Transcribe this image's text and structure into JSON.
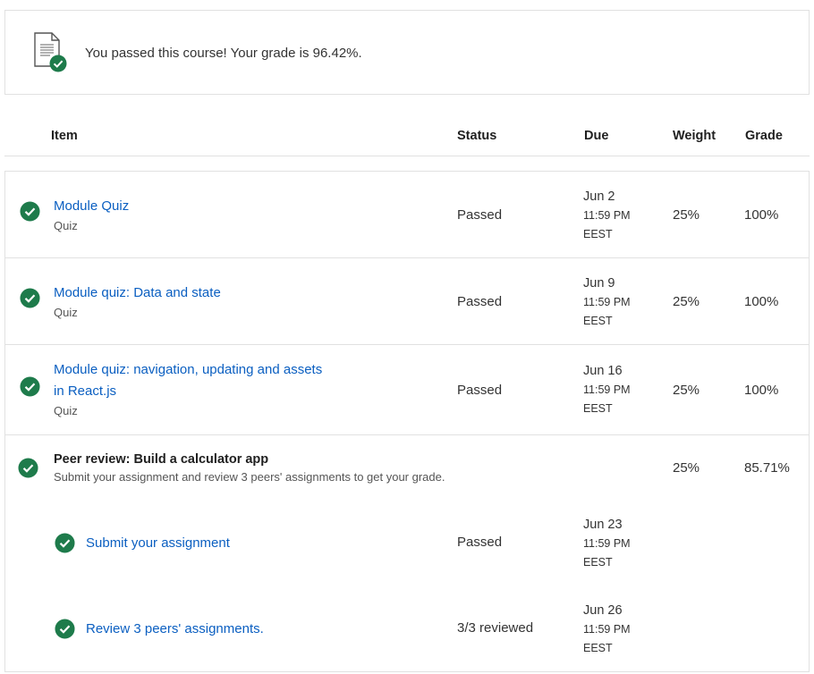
{
  "banner": {
    "icon": "document-check-icon",
    "message": "You passed this course! Your grade is 96.42%."
  },
  "columns": {
    "item": "Item",
    "status": "Status",
    "due": "Due",
    "weight": "Weight",
    "grade": "Grade"
  },
  "rows": [
    {
      "title": "Module Quiz",
      "type": "Quiz",
      "status": "Passed",
      "due_date": "Jun 2",
      "due_time": "11:59 PM",
      "due_tz": "EEST",
      "weight": "25%",
      "grade": "100%"
    },
    {
      "title": "Module quiz: Data and state",
      "type": "Quiz",
      "status": "Passed",
      "due_date": "Jun 9",
      "due_time": "11:59 PM",
      "due_tz": "EEST",
      "weight": "25%",
      "grade": "100%"
    },
    {
      "title_line1": "Module quiz: navigation, updating and assets",
      "title_line2": "in React.js",
      "type": "Quiz",
      "status": "Passed",
      "due_date": "Jun 16",
      "due_time": "11:59 PM",
      "due_tz": "EEST",
      "weight": "25%",
      "grade": "100%"
    }
  ],
  "peer_review": {
    "title": "Peer review: Build a calculator app",
    "description": "Submit your assignment and review 3 peers' assignments to get your grade.",
    "weight": "25%",
    "grade": "85.71%",
    "subitems": [
      {
        "title": "Submit your assignment",
        "status": "Passed",
        "due_date": "Jun 23",
        "due_time": "11:59 PM",
        "due_tz": "EEST"
      },
      {
        "title": "Review 3 peers' assignments.",
        "status": "3/3 reviewed",
        "due_date": "Jun 26",
        "due_time": "11:59 PM",
        "due_tz": "EEST"
      }
    ]
  },
  "colors": {
    "check_green": "#1e7b4b",
    "link_blue": "#0b5fc1",
    "border": "#e1e1e1"
  }
}
